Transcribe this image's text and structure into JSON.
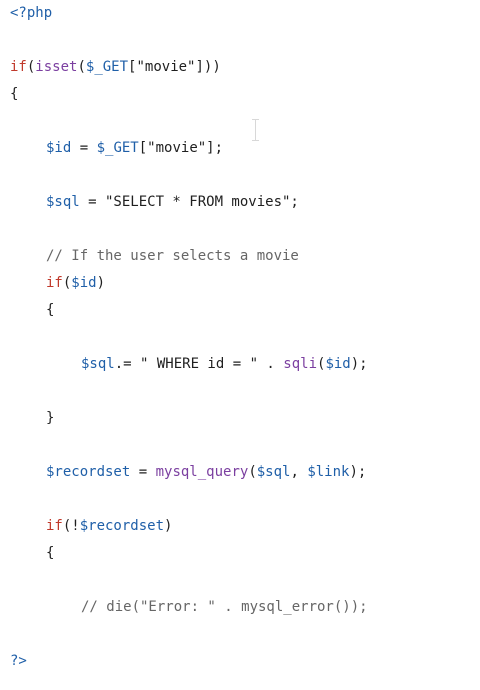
{
  "code": {
    "lines": {
      "l1": "<?php",
      "l2a": "if",
      "l2b": "(",
      "l2c": "isset",
      "l2d": "(",
      "l2e": "$_GET",
      "l2f": "[\"movie\"]))",
      "l3": "{",
      "l4a": "$id",
      "l4b": " = ",
      "l4c": "$_GET",
      "l4d": "[\"movie\"];",
      "l5a": "$sql",
      "l5b": " = \"SELECT * FROM movies\";",
      "l6": "// If the user selects a movie",
      "l7a": "if",
      "l7b": "(",
      "l7c": "$id",
      "l7d": ")",
      "l8": "{",
      "l9a": "$sql",
      "l9b": ".= \" WHERE id = \" . ",
      "l9c": "sqli",
      "l9d": "(",
      "l9e": "$id",
      "l9f": ");",
      "l10": "}",
      "l11a": "$recordset",
      "l11b": " = ",
      "l11c": "mysql_query",
      "l11d": "(",
      "l11e": "$sql",
      "l11f": ", ",
      "l11g": "$link",
      "l11h": ");",
      "l12a": "if",
      "l12b": "(!",
      "l12c": "$recordset",
      "l12d": ")",
      "l13": "{",
      "l14": "// die(\"Error: \" . mysql_error());",
      "l15": "?>"
    }
  },
  "colors": {
    "keyword": "#c0392b",
    "function": "#7b3fa0",
    "variable": "#1f5fa8",
    "comment": "#666666",
    "text": "#1f1f1f"
  },
  "icons": {
    "cursor": "text-cursor-icon"
  }
}
